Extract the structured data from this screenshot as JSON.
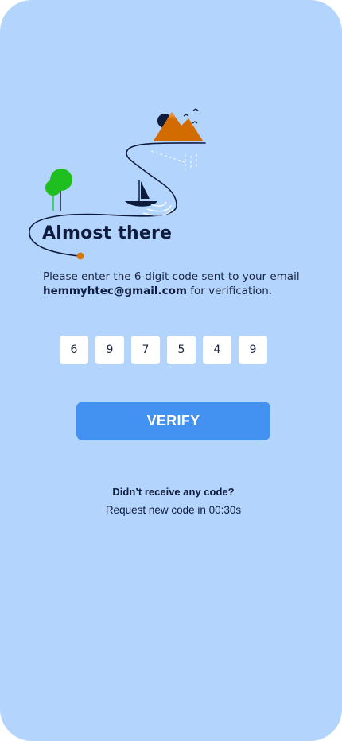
{
  "heading": {
    "title": "Almost there"
  },
  "description": {
    "prefix": "Please enter the 6-digit code sent to your email ",
    "email": "hemmyhtec@gmail.com",
    "suffix": " for verification."
  },
  "code": {
    "digits": [
      "6",
      "9",
      "7",
      "5",
      "4",
      "9"
    ]
  },
  "verify_button": {
    "label": "VERIFY"
  },
  "resend": {
    "question": "Didn’t receive any code?",
    "timer_text": "Request new code in 00:30s"
  },
  "colors": {
    "background": "#b3d5fd",
    "primary_button": "#4392f1",
    "text_dark": "#0f1b3d",
    "accent_orange": "#d97706",
    "tree_green": "#1fbf1f"
  },
  "illustration": {
    "icons": [
      "tree-icon",
      "sailboat-icon",
      "mountains-icon",
      "birds-icon",
      "sun-icon",
      "dot-icon"
    ]
  }
}
